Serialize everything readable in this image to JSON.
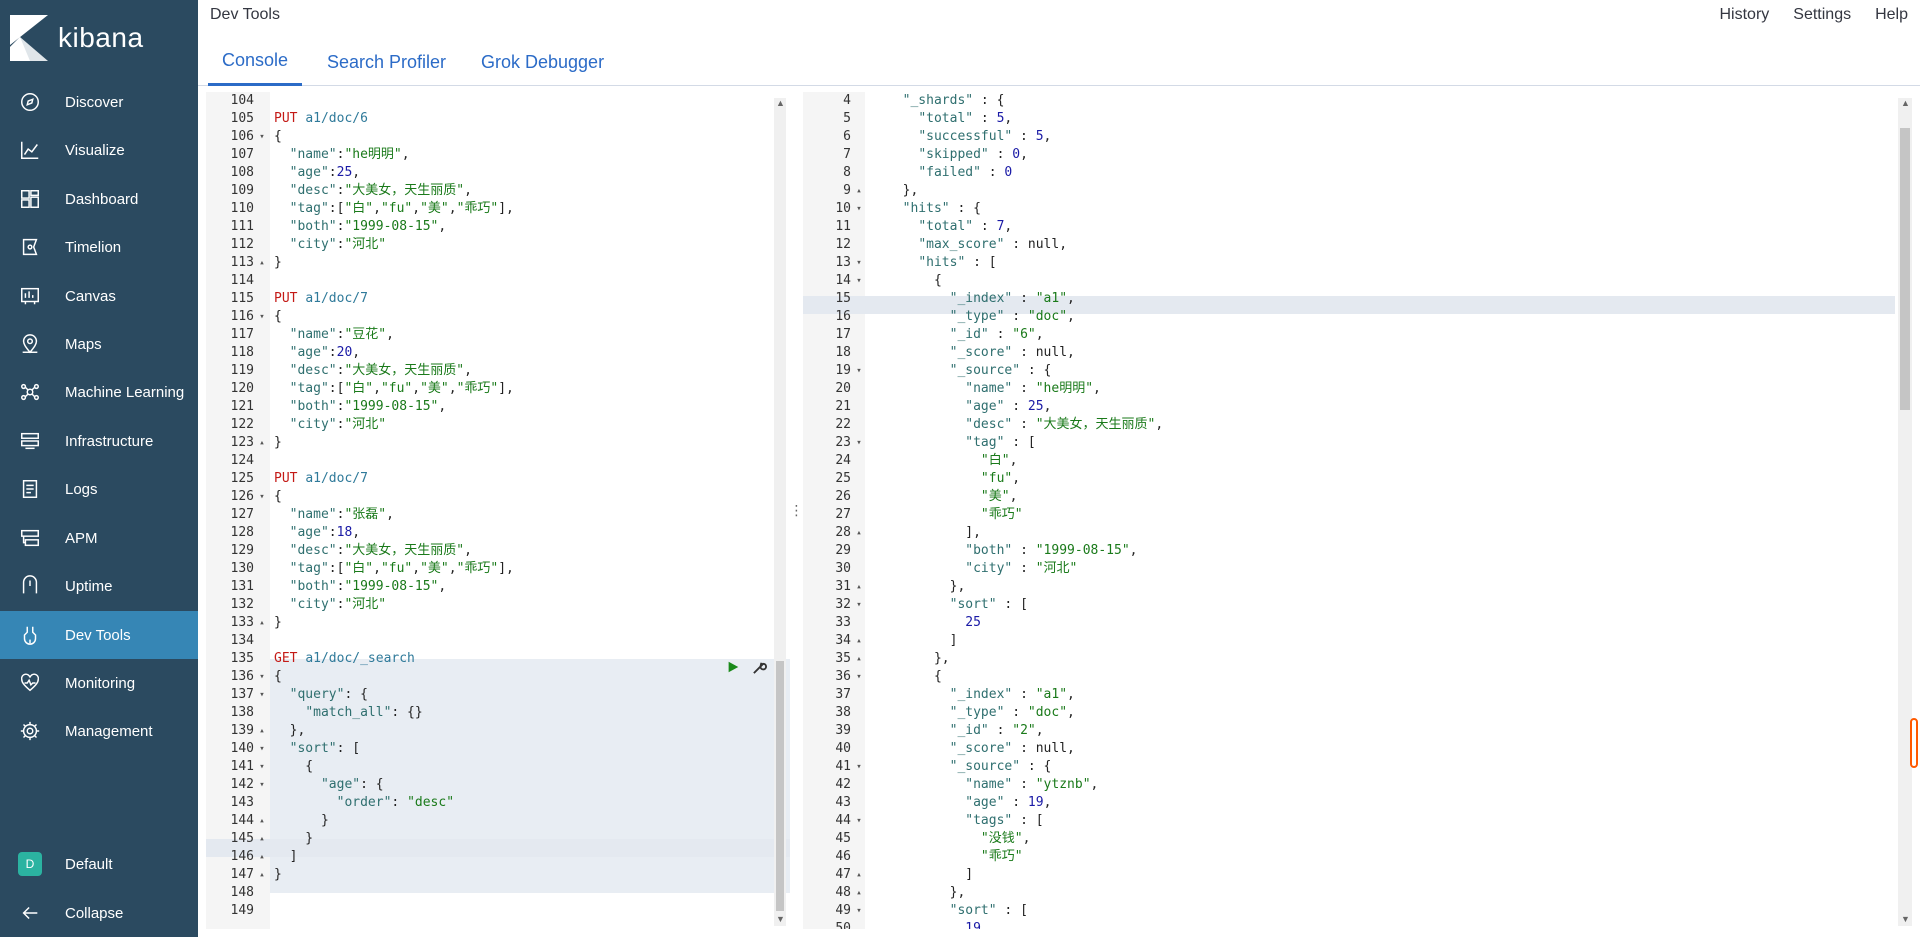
{
  "app": {
    "brand": "kibana",
    "breadcrumb": "Dev Tools",
    "top_links": [
      "History",
      "Settings",
      "Help"
    ]
  },
  "tabs": [
    {
      "label": "Console",
      "active": true
    },
    {
      "label": "Search Profiler",
      "active": false
    },
    {
      "label": "Grok Debugger",
      "active": false
    }
  ],
  "sidebar": {
    "items": [
      {
        "label": "Discover",
        "icon": "compass-icon"
      },
      {
        "label": "Visualize",
        "icon": "chart-icon"
      },
      {
        "label": "Dashboard",
        "icon": "dashboard-icon"
      },
      {
        "label": "Timelion",
        "icon": "timelion-icon"
      },
      {
        "label": "Canvas",
        "icon": "canvas-icon"
      },
      {
        "label": "Maps",
        "icon": "map-icon"
      },
      {
        "label": "Machine Learning",
        "icon": "ml-icon"
      },
      {
        "label": "Infrastructure",
        "icon": "infrastructure-icon"
      },
      {
        "label": "Logs",
        "icon": "logs-icon"
      },
      {
        "label": "APM",
        "icon": "apm-icon"
      },
      {
        "label": "Uptime",
        "icon": "uptime-icon"
      },
      {
        "label": "Dev Tools",
        "icon": "devtools-icon",
        "active": true
      },
      {
        "label": "Monitoring",
        "icon": "monitoring-icon"
      },
      {
        "label": "Management",
        "icon": "gear-icon"
      }
    ],
    "space": {
      "badge": "D",
      "label": "Default"
    },
    "collapse_label": "Collapse"
  },
  "colors": {
    "sidebar_bg": "#2b4a60",
    "active_item": "#3686b5",
    "tab_accent": "#2b6bc7"
  },
  "left_editor": {
    "lines": [
      {
        "n": "104",
        "fold": "",
        "code": ""
      },
      {
        "n": "105",
        "fold": "",
        "code": "PUT a1/doc/6"
      },
      {
        "n": "106",
        "fold": "▾",
        "code": "{"
      },
      {
        "n": "107",
        "fold": "",
        "code": "  \"name\":\"he明明\","
      },
      {
        "n": "108",
        "fold": "",
        "code": "  \"age\":25,"
      },
      {
        "n": "109",
        "fold": "",
        "code": "  \"desc\":\"大美女，天生丽质\","
      },
      {
        "n": "110",
        "fold": "",
        "code": "  \"tag\":[\"白\",\"fu\",\"美\",\"乖巧\"],"
      },
      {
        "n": "111",
        "fold": "",
        "code": "  \"both\":\"1999-08-15\","
      },
      {
        "n": "112",
        "fold": "",
        "code": "  \"city\":\"河北\""
      },
      {
        "n": "113",
        "fold": "▴",
        "code": "}"
      },
      {
        "n": "114",
        "fold": "",
        "code": ""
      },
      {
        "n": "115",
        "fold": "",
        "code": "PUT a1/doc/7"
      },
      {
        "n": "116",
        "fold": "▾",
        "code": "{"
      },
      {
        "n": "117",
        "fold": "",
        "code": "  \"name\":\"豆花\","
      },
      {
        "n": "118",
        "fold": "",
        "code": "  \"age\":20,"
      },
      {
        "n": "119",
        "fold": "",
        "code": "  \"desc\":\"大美女，天生丽质\","
      },
      {
        "n": "120",
        "fold": "",
        "code": "  \"tag\":[\"白\",\"fu\",\"美\",\"乖巧\"],"
      },
      {
        "n": "121",
        "fold": "",
        "code": "  \"both\":\"1999-08-15\","
      },
      {
        "n": "122",
        "fold": "",
        "code": "  \"city\":\"河北\""
      },
      {
        "n": "123",
        "fold": "▴",
        "code": "}"
      },
      {
        "n": "124",
        "fold": "",
        "code": ""
      },
      {
        "n": "125",
        "fold": "",
        "code": "PUT a1/doc/7"
      },
      {
        "n": "126",
        "fold": "▾",
        "code": "{"
      },
      {
        "n": "127",
        "fold": "",
        "code": "  \"name\":\"张磊\","
      },
      {
        "n": "128",
        "fold": "",
        "code": "  \"age\":18,"
      },
      {
        "n": "129",
        "fold": "",
        "code": "  \"desc\":\"大美女，天生丽质\","
      },
      {
        "n": "130",
        "fold": "",
        "code": "  \"tag\":[\"白\",\"fu\",\"美\",\"乖巧\"],"
      },
      {
        "n": "131",
        "fold": "",
        "code": "  \"both\":\"1999-08-15\","
      },
      {
        "n": "132",
        "fold": "",
        "code": "  \"city\":\"河北\""
      },
      {
        "n": "133",
        "fold": "▴",
        "code": "}"
      },
      {
        "n": "134",
        "fold": "",
        "code": ""
      },
      {
        "n": "135",
        "fold": "",
        "code": "GET a1/doc/_search"
      },
      {
        "n": "136",
        "fold": "▾",
        "code": "{"
      },
      {
        "n": "137",
        "fold": "▾",
        "code": "  \"query\": {"
      },
      {
        "n": "138",
        "fold": "",
        "code": "    \"match_all\": {}"
      },
      {
        "n": "139",
        "fold": "▴",
        "code": "  },"
      },
      {
        "n": "140",
        "fold": "▾",
        "code": "  \"sort\": ["
      },
      {
        "n": "141",
        "fold": "▾",
        "code": "    {"
      },
      {
        "n": "142",
        "fold": "▾",
        "code": "      \"age\": {"
      },
      {
        "n": "143",
        "fold": "",
        "code": "        \"order\": \"desc\""
      },
      {
        "n": "144",
        "fold": "▴",
        "code": "      }"
      },
      {
        "n": "145",
        "fold": "▴",
        "code": "    }"
      },
      {
        "n": "146",
        "fold": "▴",
        "code": "  ]"
      },
      {
        "n": "147",
        "fold": "▴",
        "code": "}"
      },
      {
        "n": "148",
        "fold": "",
        "code": ""
      },
      {
        "n": "149",
        "fold": "",
        "code": ""
      }
    ]
  },
  "right_editor": {
    "lines": [
      {
        "n": "4",
        "fold": "",
        "code": "  \"_shards\" : {"
      },
      {
        "n": "5",
        "fold": "",
        "code": "    \"total\" : 5,"
      },
      {
        "n": "6",
        "fold": "",
        "code": "    \"successful\" : 5,"
      },
      {
        "n": "7",
        "fold": "",
        "code": "    \"skipped\" : 0,"
      },
      {
        "n": "8",
        "fold": "",
        "code": "    \"failed\" : 0"
      },
      {
        "n": "9",
        "fold": "▴",
        "code": "  },"
      },
      {
        "n": "10",
        "fold": "▾",
        "code": "  \"hits\" : {"
      },
      {
        "n": "11",
        "fold": "",
        "code": "    \"total\" : 7,"
      },
      {
        "n": "12",
        "fold": "",
        "code": "    \"max_score\" : null,"
      },
      {
        "n": "13",
        "fold": "▾",
        "code": "    \"hits\" : ["
      },
      {
        "n": "14",
        "fold": "▾",
        "code": "      {"
      },
      {
        "n": "15",
        "fold": "",
        "code": "        \"_index\" : \"a1\","
      },
      {
        "n": "16",
        "fold": "",
        "code": "        \"_type\" : \"doc\","
      },
      {
        "n": "17",
        "fold": "",
        "code": "        \"_id\" : \"6\","
      },
      {
        "n": "18",
        "fold": "",
        "code": "        \"_score\" : null,"
      },
      {
        "n": "19",
        "fold": "▾",
        "code": "        \"_source\" : {"
      },
      {
        "n": "20",
        "fold": "",
        "code": "          \"name\" : \"he明明\","
      },
      {
        "n": "21",
        "fold": "",
        "code": "          \"age\" : 25,"
      },
      {
        "n": "22",
        "fold": "",
        "code": "          \"desc\" : \"大美女，天生丽质\","
      },
      {
        "n": "23",
        "fold": "▾",
        "code": "          \"tag\" : ["
      },
      {
        "n": "24",
        "fold": "",
        "code": "            \"白\","
      },
      {
        "n": "25",
        "fold": "",
        "code": "            \"fu\","
      },
      {
        "n": "26",
        "fold": "",
        "code": "            \"美\","
      },
      {
        "n": "27",
        "fold": "",
        "code": "            \"乖巧\""
      },
      {
        "n": "28",
        "fold": "▴",
        "code": "          ],"
      },
      {
        "n": "29",
        "fold": "",
        "code": "          \"both\" : \"1999-08-15\","
      },
      {
        "n": "30",
        "fold": "",
        "code": "          \"city\" : \"河北\""
      },
      {
        "n": "31",
        "fold": "▴",
        "code": "        },"
      },
      {
        "n": "32",
        "fold": "▾",
        "code": "        \"sort\" : ["
      },
      {
        "n": "33",
        "fold": "",
        "code": "          25"
      },
      {
        "n": "34",
        "fold": "▴",
        "code": "        ]"
      },
      {
        "n": "35",
        "fold": "▴",
        "code": "      },"
      },
      {
        "n": "36",
        "fold": "▾",
        "code": "      {"
      },
      {
        "n": "37",
        "fold": "",
        "code": "        \"_index\" : \"a1\","
      },
      {
        "n": "38",
        "fold": "",
        "code": "        \"_type\" : \"doc\","
      },
      {
        "n": "39",
        "fold": "",
        "code": "        \"_id\" : \"2\","
      },
      {
        "n": "40",
        "fold": "",
        "code": "        \"_score\" : null,"
      },
      {
        "n": "41",
        "fold": "▾",
        "code": "        \"_source\" : {"
      },
      {
        "n": "42",
        "fold": "",
        "code": "          \"name\" : \"ytznb\","
      },
      {
        "n": "43",
        "fold": "",
        "code": "          \"age\" : 19,"
      },
      {
        "n": "44",
        "fold": "▾",
        "code": "          \"tags\" : ["
      },
      {
        "n": "45",
        "fold": "",
        "code": "            \"没钱\","
      },
      {
        "n": "46",
        "fold": "",
        "code": "            \"乖巧\""
      },
      {
        "n": "47",
        "fold": "▴",
        "code": "          ]"
      },
      {
        "n": "48",
        "fold": "▴",
        "code": "        },"
      },
      {
        "n": "49",
        "fold": "▾",
        "code": "        \"sort\" : ["
      },
      {
        "n": "50",
        "fold": "",
        "code": "          19"
      }
    ]
  }
}
